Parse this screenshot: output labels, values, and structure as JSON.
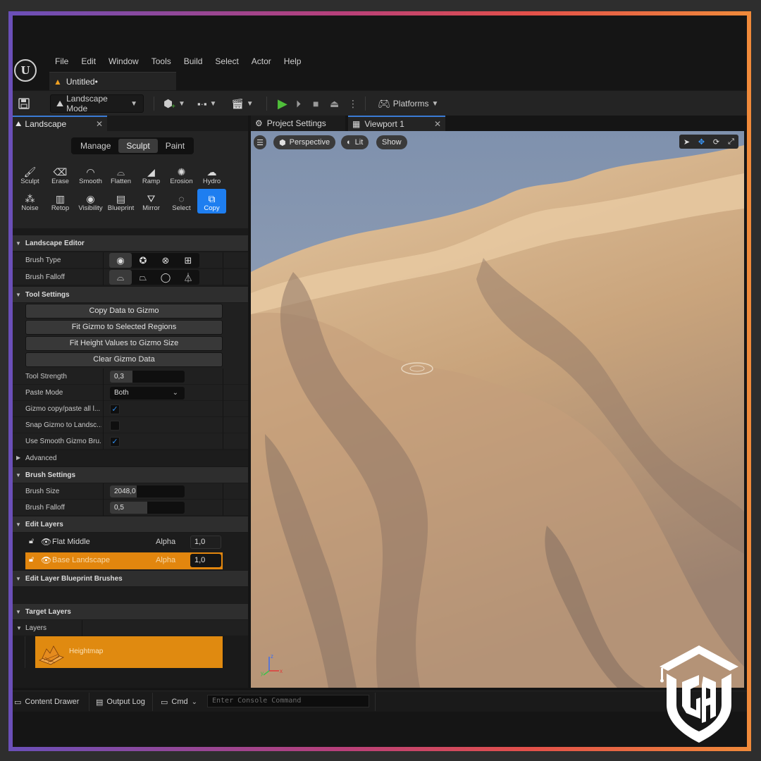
{
  "menu": {
    "items": [
      "File",
      "Edit",
      "Window",
      "Tools",
      "Build",
      "Select",
      "Actor",
      "Help"
    ]
  },
  "document_tab": {
    "title": "Untitled•"
  },
  "toolbar": {
    "mode_label": "Landscape Mode",
    "platforms_label": "Platforms"
  },
  "landscape_panel": {
    "tab_label": "Landscape",
    "modes": [
      "Manage",
      "Sculpt",
      "Paint"
    ],
    "selected_mode": "Sculpt",
    "tools": [
      {
        "label": "Sculpt",
        "icon": "brush-icon"
      },
      {
        "label": "Erase",
        "icon": "eraser-icon"
      },
      {
        "label": "Smooth",
        "icon": "smooth-icon"
      },
      {
        "label": "Flatten",
        "icon": "flatten-icon"
      },
      {
        "label": "Ramp",
        "icon": "ramp-icon"
      },
      {
        "label": "Erosion",
        "icon": "erosion-icon"
      },
      {
        "label": "Hydro",
        "icon": "hydro-icon"
      },
      {
        "label": "Noise",
        "icon": "noise-icon"
      },
      {
        "label": "Retop",
        "icon": "retop-icon"
      },
      {
        "label": "Visibility",
        "icon": "visibility-icon"
      },
      {
        "label": "Blueprint",
        "icon": "blueprint-icon"
      },
      {
        "label": "Mirror",
        "icon": "mirror-icon"
      },
      {
        "label": "Select",
        "icon": "select-icon"
      },
      {
        "label": "Copy",
        "icon": "copy-icon"
      }
    ],
    "active_tool": "Copy",
    "landscape_editor": {
      "title": "Landscape Editor",
      "brush_type_label": "Brush Type",
      "brush_falloff_label": "Brush Falloff"
    },
    "tool_settings": {
      "title": "Tool Settings",
      "buttons": [
        "Copy Data to Gizmo",
        "Fit Gizmo to Selected Regions",
        "Fit Height Values to Gizmo Size",
        "Clear Gizmo Data"
      ],
      "tool_strength_label": "Tool Strength",
      "tool_strength_value": "0,3",
      "tool_strength_fill": 0.3,
      "paste_mode_label": "Paste Mode",
      "paste_mode_value": "Both",
      "gizmo_copy_label": "Gizmo copy/paste all l...",
      "gizmo_copy_checked": true,
      "snap_gizmo_label": "Snap Gizmo to Landsc...",
      "snap_gizmo_checked": false,
      "use_smooth_label": "Use Smooth Gizmo Bru...",
      "use_smooth_checked": true,
      "advanced_label": "Advanced"
    },
    "brush_settings": {
      "title": "Brush Settings",
      "brush_size_label": "Brush Size",
      "brush_size_value": "2048,0",
      "brush_size_fill": 0.36,
      "brush_falloff_label": "Brush Falloff",
      "brush_falloff_value": "0,5",
      "brush_falloff_fill": 0.5
    },
    "edit_layers": {
      "title": "Edit Layers",
      "layers": [
        {
          "name": "Flat Middle",
          "alpha_label": "Alpha",
          "alpha": "1,0",
          "active": false
        },
        {
          "name": "Base Landscape",
          "alpha_label": "Alpha",
          "alpha": "1,0",
          "active": true
        }
      ]
    },
    "blueprint_brushes": {
      "title": "Edit Layer Blueprint Brushes"
    },
    "target_layers": {
      "title": "Target Layers",
      "layers_label": "Layers",
      "heightmap_label": "Heightmap"
    }
  },
  "viewport": {
    "tabs": [
      "Project Settings",
      "Viewport 1"
    ],
    "view_mode": "Perspective",
    "lighting": "Lit",
    "show_label": "Show",
    "sky_color": "#8e9eb6",
    "sand_color": "#d9b58a"
  },
  "bottom_bar": {
    "content_drawer": "Content Drawer",
    "output_log": "Output Log",
    "cmd": "Cmd",
    "console_placeholder": "Enter Console Command"
  },
  "colors": {
    "accent_blue": "#1e7ef0",
    "active_orange": "#e2860e",
    "play_green": "#4fbf3a"
  }
}
